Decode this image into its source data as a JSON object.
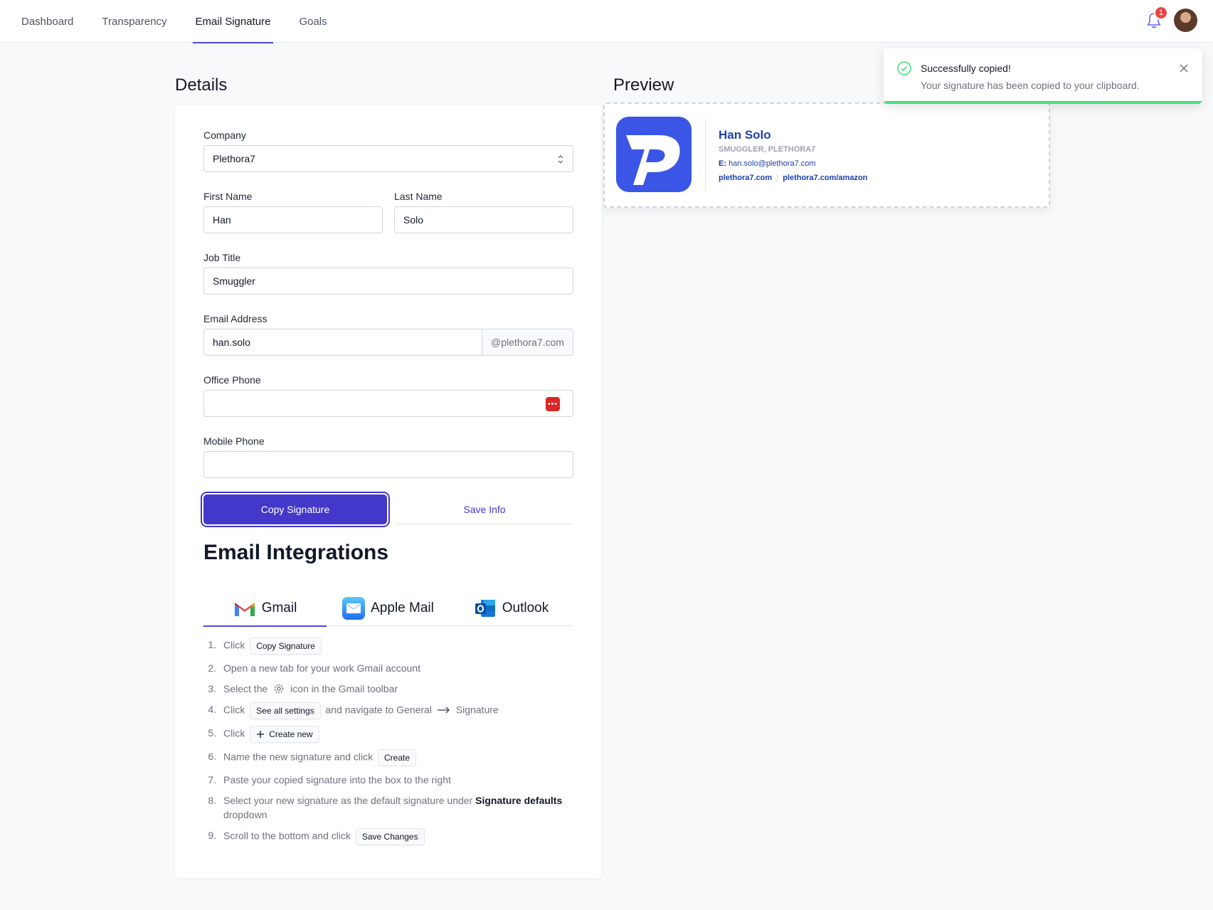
{
  "nav": {
    "tabs": [
      "Dashboard",
      "Transparency",
      "Email Signature",
      "Goals"
    ],
    "active_tab": "Email Signature",
    "notification_count": "1",
    "accent": "#4f46e5"
  },
  "details": {
    "heading": "Details",
    "company": {
      "label": "Company",
      "value": "Plethora7"
    },
    "first_name": {
      "label": "First Name",
      "value": "Han"
    },
    "last_name": {
      "label": "Last Name",
      "value": "Solo"
    },
    "job_title": {
      "label": "Job Title",
      "value": "Smuggler"
    },
    "email": {
      "label": "Email Address",
      "value": "han.solo",
      "domain": "@plethora7.com"
    },
    "office_phone": {
      "label": "Office Phone",
      "value": ""
    },
    "mobile_phone": {
      "label": "Mobile Phone",
      "value": ""
    },
    "copy_button": "Copy Signature",
    "save_button": "Save Info"
  },
  "integrations": {
    "heading": "Email Integrations",
    "tabs": [
      {
        "label": "Gmail",
        "icon": "gmail-icon"
      },
      {
        "label": "Apple Mail",
        "icon": "apple-mail-icon"
      },
      {
        "label": "Outlook",
        "icon": "outlook-icon"
      }
    ],
    "active_tab": "Gmail",
    "steps": {
      "s1": {
        "a": "Click",
        "k": "Copy Signature"
      },
      "s2": {
        "a": "Open a new tab for your work Gmail account"
      },
      "s3": {
        "a": "Select the",
        "b": "icon in the Gmail toolbar",
        "icon": "gear-icon"
      },
      "s4": {
        "a": "Click",
        "k": "See all settings",
        "b": "and navigate to General",
        "c": "Signature",
        "icon": "arrow-right-icon"
      },
      "s5": {
        "a": "Click",
        "k": "Create new",
        "icon": "plus-icon"
      },
      "s6": {
        "a": "Name the new signature and click",
        "k": "Create"
      },
      "s7": {
        "a": "Paste your copied signature into the box to the right"
      },
      "s8": {
        "a": "Select your new signature as the default signature under",
        "strong": "Signature defaults",
        "b": "dropdown"
      },
      "s9": {
        "a": "Scroll to the bottom and click",
        "k": "Save Changes"
      }
    }
  },
  "preview": {
    "heading": "Preview",
    "name": "Han Solo",
    "title": "SMUGGLER, PLETHORA7",
    "email_prefix": "E:",
    "email": "han.solo@plethora7.com",
    "link1": "plethora7.com",
    "link2": "plethora7.com/amazon",
    "logo_color": "#3b55e6"
  },
  "toast": {
    "title": "Successfully copied!",
    "message": "Your signature has been copied to your clipboard.",
    "status_color": "#4ade80"
  }
}
